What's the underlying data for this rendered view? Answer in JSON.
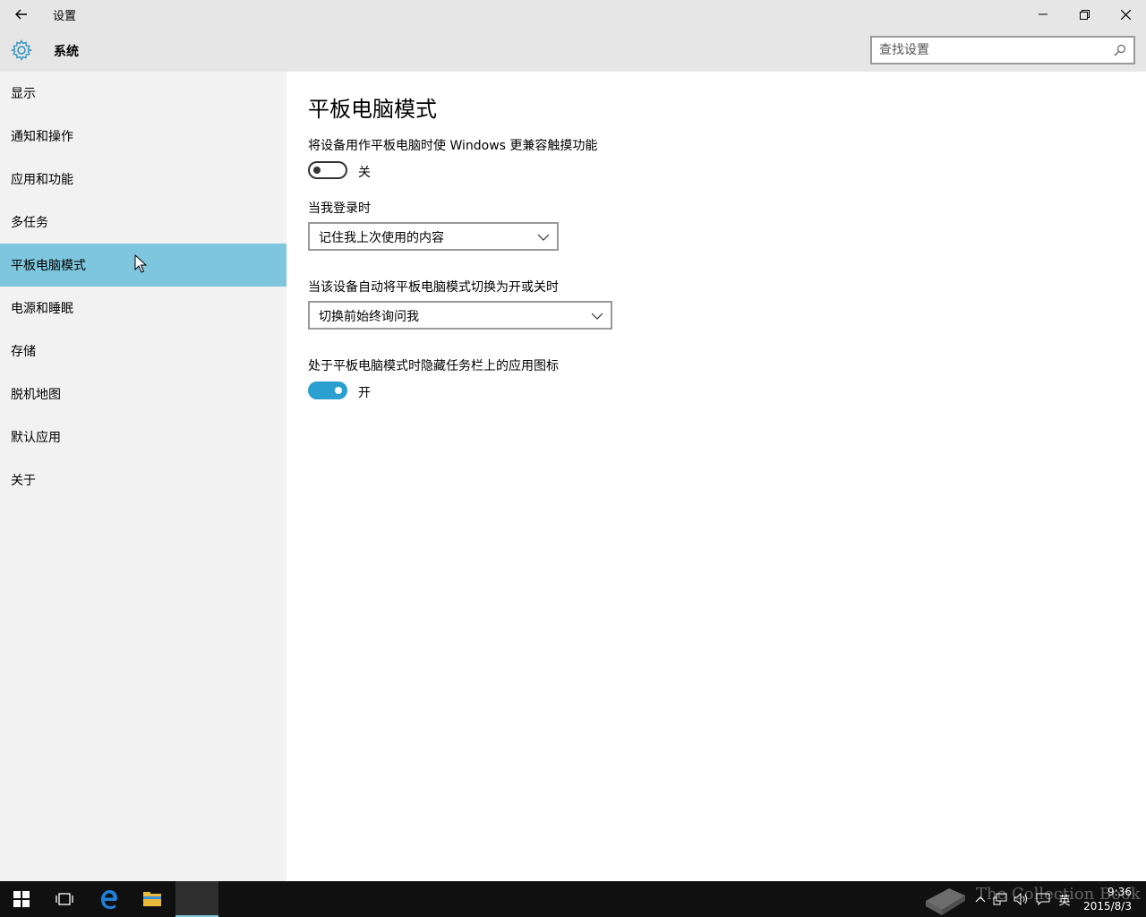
{
  "window": {
    "title": "设置"
  },
  "header": {
    "section_title": "系统",
    "search_placeholder": "查找设置"
  },
  "sidebar": {
    "items": [
      {
        "label": "显示"
      },
      {
        "label": "通知和操作"
      },
      {
        "label": "应用和功能"
      },
      {
        "label": "多任务"
      },
      {
        "label": "平板电脑模式",
        "active": true
      },
      {
        "label": "电源和睡眠"
      },
      {
        "label": "存储"
      },
      {
        "label": "脱机地图"
      },
      {
        "label": "默认应用"
      },
      {
        "label": "关于"
      }
    ]
  },
  "main": {
    "page_title": "平板电脑模式",
    "tablet_mode": {
      "label": "将设备用作平板电脑时使 Windows 更兼容触摸功能",
      "state": "关",
      "on": false
    },
    "signin": {
      "label": "当我登录时",
      "value": "记住我上次使用的内容"
    },
    "auto_switch": {
      "label": "当该设备自动将平板电脑模式切换为开或关时",
      "value": "切换前始终询问我"
    },
    "hide_icons": {
      "label": "处于平板电脑模式时隐藏任务栏上的应用图标",
      "state": "开",
      "on": true
    }
  },
  "taskbar": {
    "ime": "英",
    "time": "9:36",
    "date": "2015/8/3",
    "watermark": "The Collection Book"
  },
  "colors": {
    "accent": "#2a9fd0",
    "nav_selected": "#7ec6dd",
    "titlebar_bg": "#e6e6e6",
    "taskbar_bg": "#101010"
  }
}
